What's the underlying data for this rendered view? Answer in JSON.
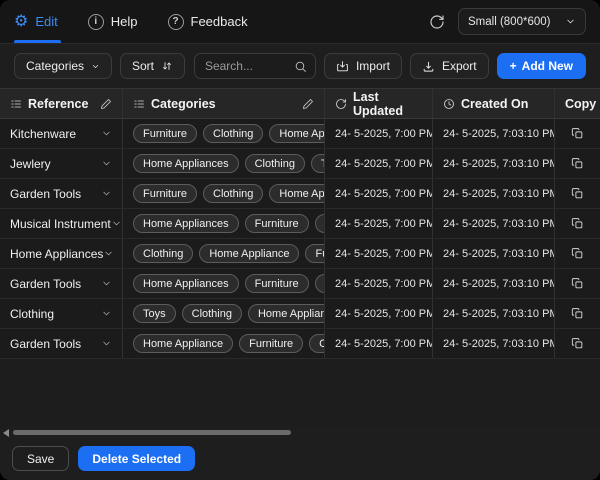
{
  "topbar": {
    "edit_tab": "Edit",
    "help": "Help",
    "feedback": "Feedback",
    "size_option": "Small (800*600)"
  },
  "icons": {
    "gear_glyph": "⚙",
    "info_glyph": "i",
    "question_glyph": "?",
    "add_new_plus": "+"
  },
  "toolbar": {
    "categories": "Categories",
    "sort": "Sort",
    "search_placeholder": "Search...",
    "import": "Import",
    "export": "Export",
    "add_new": "Add New"
  },
  "table": {
    "headers": {
      "reference": "Reference",
      "categories": "Categories",
      "last_updated": "Last Updated",
      "created_on": "Created On",
      "copy": "Copy"
    },
    "rows": [
      {
        "reference": "Kitchenware",
        "tags": [
          "Furniture",
          "Clothing",
          "Home Appliance"
        ],
        "last_updated": "24- 5-2025, 7:00 PM",
        "created_on": "24- 5-2025, 7:03:10 PM"
      },
      {
        "reference": "Jewlery",
        "tags": [
          "Home Appliances",
          "Clothing",
          "Toys"
        ],
        "last_updated": "24- 5-2025, 7:00 PM",
        "created_on": "24- 5-2025, 7:03:10 PM"
      },
      {
        "reference": "Garden Tools",
        "tags": [
          "Furniture",
          "Clothing",
          "Home Appliance"
        ],
        "last_updated": "24- 5-2025, 7:00 PM",
        "created_on": "24- 5-2025, 7:03:10 PM"
      },
      {
        "reference": "Musical Instrument",
        "tags": [
          "Home Appliances",
          "Furniture",
          "Toys"
        ],
        "last_updated": "24- 5-2025, 7:00 PM",
        "created_on": "24- 5-2025, 7:03:10 PM"
      },
      {
        "reference": "Home Appliances",
        "tags": [
          "Clothing",
          "Home Appliance",
          "Furniture"
        ],
        "last_updated": "24- 5-2025, 7:00 PM",
        "created_on": "24- 5-2025, 7:03:10 PM"
      },
      {
        "reference": "Garden Tools",
        "tags": [
          "Home Appliances",
          "Furniture",
          "Toys"
        ],
        "last_updated": "24- 5-2025, 7:00 PM",
        "created_on": "24- 5-2025, 7:03:10 PM"
      },
      {
        "reference": "Clothing",
        "tags": [
          "Toys",
          "Clothing",
          "Home Appliance"
        ],
        "last_updated": "24- 5-2025, 7:00 PM",
        "created_on": "24- 5-2025, 7:03:10 PM"
      },
      {
        "reference": "Garden Tools",
        "tags": [
          "Home Appliance",
          "Furniture",
          "Clothing"
        ],
        "last_updated": "24- 5-2025, 7:00 PM",
        "created_on": "24- 5-2025, 7:03:10 PM"
      }
    ]
  },
  "footer": {
    "save": "Save",
    "delete_selected": "Delete Selected"
  },
  "colors": {
    "accent_blue": "#1c6ef2",
    "edit_text_blue": "#3f8cf3"
  }
}
